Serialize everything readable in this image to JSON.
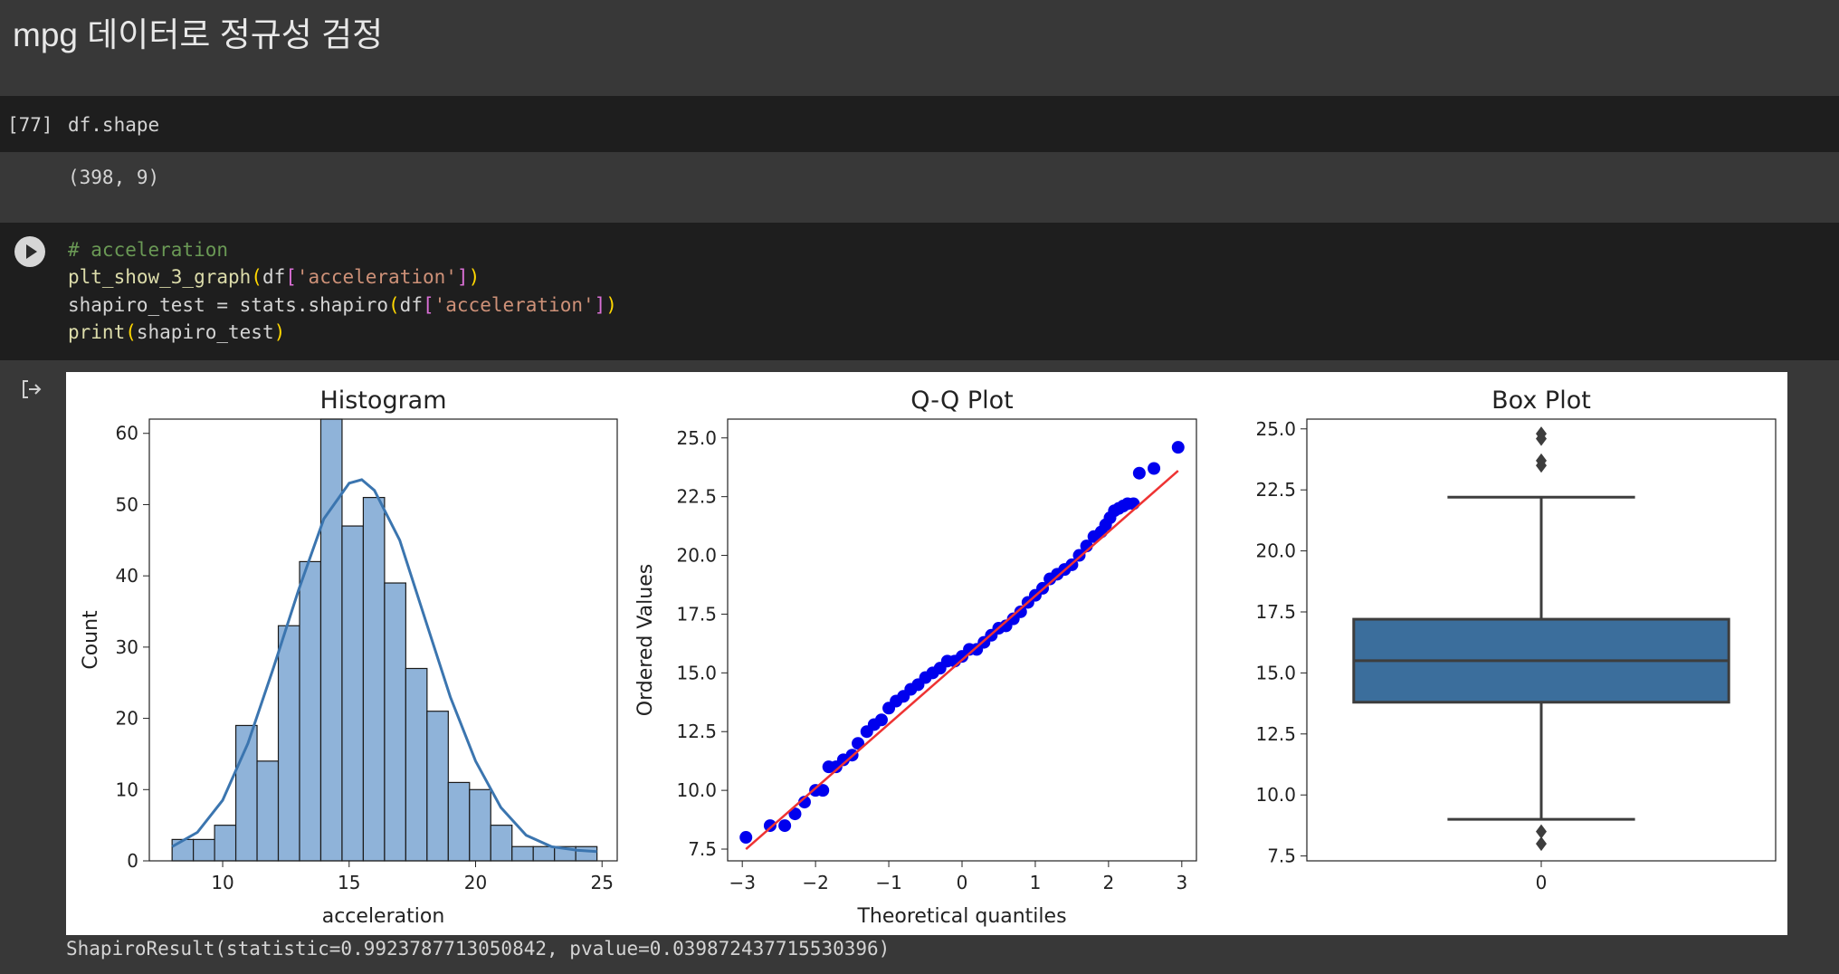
{
  "heading": "mpg 데이터로 정규성 검정",
  "cell1": {
    "prompt": "[77]",
    "code": "df.shape",
    "output": "(398, 9)"
  },
  "cell2": {
    "comment": "# acceleration",
    "line2": {
      "fn": "plt_show_3_graph",
      "p1": "(",
      "a": "df",
      "p2": "[",
      "s": "'acceleration'",
      "p3": "]",
      "p4": ")"
    },
    "line3": {
      "pre": "shapiro_test = stats.shapiro",
      "p1": "(",
      "a": "df",
      "p2": "[",
      "s": "'acceleration'",
      "p3": "]",
      "p4": ")"
    },
    "line4": {
      "fn": "print",
      "p1": "(",
      "a": "shapiro_test",
      "p4": ")"
    },
    "result": "ShapiroResult(statistic=0.9923787713050842, pvalue=0.039872437715530396)"
  },
  "colors": {
    "bar": "#8fb3d9",
    "kde": "#3b75af",
    "qq_point": "#0000ee",
    "qq_line": "#ee3333",
    "box": "#3b6e9c"
  },
  "chart_data": [
    {
      "type": "bar",
      "title": "Histogram",
      "xlabel": "acceleration",
      "ylabel": "Count",
      "xlim": [
        7.1,
        25.6
      ],
      "ylim": [
        0,
        62
      ],
      "xticks": [
        10,
        15,
        20,
        25
      ],
      "yticks": [
        0,
        10,
        20,
        30,
        40,
        50,
        60
      ],
      "bin_edges": [
        8.0,
        8.84,
        9.68,
        10.52,
        11.36,
        12.2,
        13.04,
        13.88,
        14.72,
        15.56,
        16.4,
        17.24,
        18.08,
        18.92,
        19.76,
        20.6,
        21.44,
        22.28,
        23.12,
        23.96,
        24.8
      ],
      "values": [
        3,
        3,
        5,
        19,
        14,
        33,
        42,
        62,
        47,
        51,
        39,
        27,
        21,
        11,
        10,
        5,
        2,
        2,
        2,
        2
      ],
      "kde": {
        "x": [
          8,
          9,
          10,
          11,
          12,
          13,
          14,
          15,
          15.5,
          16,
          17,
          18,
          19,
          20,
          21,
          22,
          23,
          24,
          24.8
        ],
        "y": [
          2,
          4,
          8.5,
          16.5,
          27,
          38,
          48,
          53,
          53.5,
          52,
          45,
          34,
          23,
          14,
          7.5,
          3.6,
          2,
          1.5,
          1.3
        ]
      }
    },
    {
      "type": "scatter",
      "title": "Q-Q Plot",
      "xlabel": "Theoretical quantiles",
      "ylabel": "Ordered Values",
      "xlim": [
        -3.2,
        3.2
      ],
      "ylim": [
        7.0,
        25.8
      ],
      "xticks": [
        -3,
        -2,
        -1,
        0,
        1,
        2,
        3
      ],
      "ytick_labels": [
        "7.5",
        "10.0",
        "12.5",
        "15.0",
        "17.5",
        "20.0",
        "22.5",
        "25.0"
      ],
      "fit_line": {
        "x": [
          -2.95,
          2.95
        ],
        "y": [
          7.5,
          23.6
        ]
      },
      "points": {
        "x": [
          -2.95,
          -2.62,
          -2.42,
          -2.28,
          -2.15,
          -2.0,
          -1.9,
          -1.82,
          -1.72,
          -1.62,
          -1.5,
          -1.42,
          -1.3,
          -1.2,
          -1.1,
          -1.0,
          -0.9,
          -0.8,
          -0.7,
          -0.6,
          -0.5,
          -0.4,
          -0.3,
          -0.2,
          -0.1,
          0.0,
          0.1,
          0.2,
          0.3,
          0.4,
          0.5,
          0.6,
          0.7,
          0.8,
          0.9,
          1.0,
          1.1,
          1.2,
          1.3,
          1.4,
          1.5,
          1.6,
          1.7,
          1.8,
          1.9,
          1.96,
          2.02,
          2.08,
          2.14,
          2.2,
          2.26,
          2.34,
          2.42,
          2.62,
          2.95
        ],
        "y": [
          8.0,
          8.5,
          8.5,
          9.0,
          9.5,
          10.0,
          10.0,
          11.0,
          11.0,
          11.3,
          11.5,
          12.0,
          12.5,
          12.8,
          13.0,
          13.5,
          13.8,
          14.0,
          14.3,
          14.5,
          14.8,
          15.0,
          15.2,
          15.5,
          15.5,
          15.7,
          16.0,
          16.0,
          16.3,
          16.6,
          16.9,
          17.0,
          17.3,
          17.6,
          18.0,
          18.3,
          18.6,
          19.0,
          19.2,
          19.4,
          19.6,
          20.0,
          20.4,
          20.8,
          21.0,
          21.3,
          21.6,
          21.9,
          22.0,
          22.1,
          22.2,
          22.2,
          23.5,
          23.7,
          24.6,
          24.8
        ]
      }
    },
    {
      "type": "box",
      "title": "Box Plot",
      "category": "0",
      "ylim": [
        7.3,
        25.4
      ],
      "ytick_labels": [
        "7.5",
        "10.0",
        "12.5",
        "15.0",
        "17.5",
        "20.0",
        "22.5",
        "25.0"
      ],
      "whisker_low": 9.0,
      "q1": 13.8,
      "median": 15.5,
      "q3": 17.2,
      "whisker_high": 22.2,
      "outliers": [
        8.0,
        8.5,
        23.5,
        23.7,
        24.6,
        24.8
      ]
    }
  ]
}
